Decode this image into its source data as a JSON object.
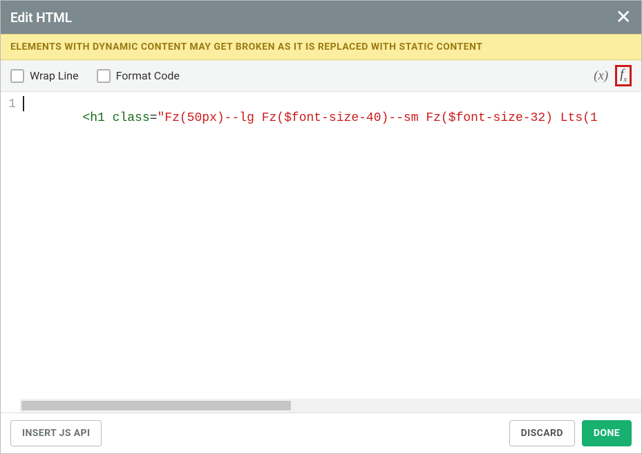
{
  "header": {
    "title": "Edit HTML"
  },
  "banner": {
    "text": "ELEMENTS WITH DYNAMIC CONTENT MAY GET BROKEN AS IT IS REPLACED WITH STATIC CONTENT"
  },
  "toolbar": {
    "wrap_line_label": "Wrap Line",
    "wrap_line_checked": false,
    "format_code_label": "Format Code",
    "format_code_checked": false,
    "variable_glyph": "(x)",
    "fx_glyph": "fx"
  },
  "editor": {
    "line_numbers": [
      "1"
    ],
    "tokens": [
      {
        "cls": "tok-tag",
        "t": "<h1"
      },
      {
        "cls": "",
        "t": " "
      },
      {
        "cls": "tok-attr",
        "t": "class"
      },
      {
        "cls": "tok-eq",
        "t": "="
      },
      {
        "cls": "tok-str",
        "t": "\"Fz(50px)--lg Fz($font-size-40)--sm Fz($font-size-32) Lts(1"
      }
    ]
  },
  "footer": {
    "insert_js_api_label": "INSERT JS API",
    "discard_label": "DISCARD",
    "done_label": "DONE"
  }
}
